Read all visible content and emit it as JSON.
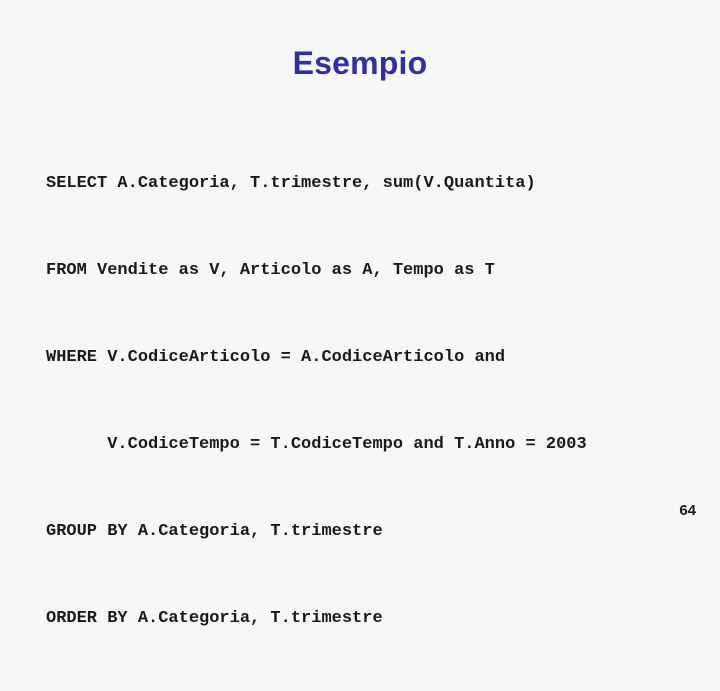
{
  "slide": {
    "title": "Esempio",
    "title_color": "#2f2fa8",
    "background_color": "#f7f7f7",
    "text_color": "#1a1a1a",
    "page_number": "64"
  },
  "code": {
    "language": "sql",
    "lines": [
      "SELECT A.Categoria, T.trimestre, sum(V.Quantita)",
      "FROM Vendite as V, Articolo as A, Tempo as T",
      "WHERE V.CodiceArticolo = A.CodiceArticolo and",
      "      V.CodiceTempo = T.CodiceTempo and T.Anno = 2003",
      "GROUP BY A.Categoria, T.trimestre",
      "ORDER BY A.Categoria, T.trimestre"
    ]
  }
}
